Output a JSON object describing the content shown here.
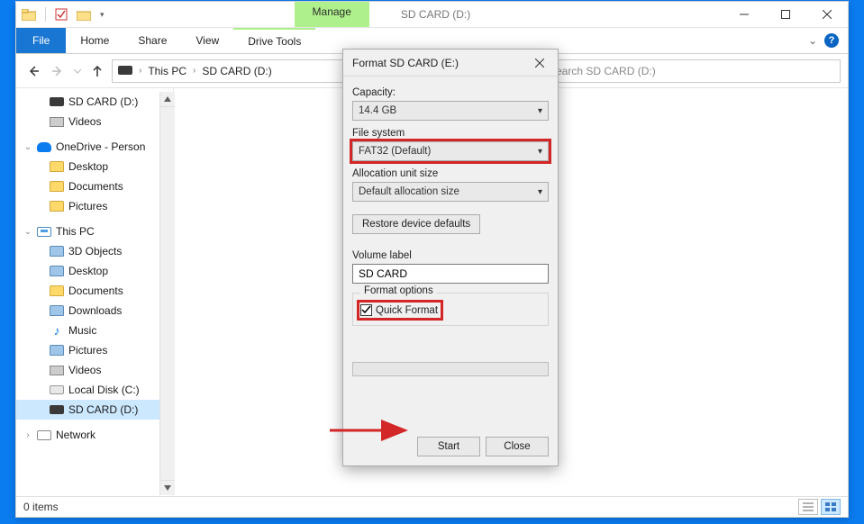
{
  "window": {
    "context_tab": "Manage",
    "title": "SD CARD (D:)"
  },
  "ribbon": {
    "file": "File",
    "tabs": [
      "Home",
      "Share",
      "View"
    ],
    "drive_tools": "Drive Tools",
    "chev": "⌄"
  },
  "nav": {
    "breadcrumb": {
      "root": "This PC",
      "current": "SD CARD (D:)"
    },
    "search_placeholder": "Search SD CARD (D:)"
  },
  "tree": {
    "top": {
      "sdcard": "SD CARD (D:)",
      "videos": "Videos"
    },
    "onedrive": {
      "label": "OneDrive - Person",
      "desktop": "Desktop",
      "documents": "Documents",
      "pictures": "Pictures"
    },
    "thispc": {
      "label": "This PC",
      "objects3d": "3D Objects",
      "desktop": "Desktop",
      "documents": "Documents",
      "downloads": "Downloads",
      "music": "Music",
      "pictures": "Pictures",
      "videos": "Videos",
      "localdisk": "Local Disk (C:)",
      "sdcard": "SD CARD (D:)"
    },
    "network": "Network"
  },
  "status": {
    "items": "0 items"
  },
  "dialog": {
    "title": "Format SD CARD (E:)",
    "capacity_label": "Capacity:",
    "capacity_value": "14.4 GB",
    "fs_label": "File system",
    "fs_value": "FAT32 (Default)",
    "alloc_label": "Allocation unit size",
    "alloc_value": "Default allocation size",
    "restore_btn": "Restore device defaults",
    "vol_label": "Volume label",
    "vol_value": "SD CARD",
    "fieldset_label": "Format options",
    "quick_label": "Quick Format",
    "start": "Start",
    "close": "Close"
  }
}
